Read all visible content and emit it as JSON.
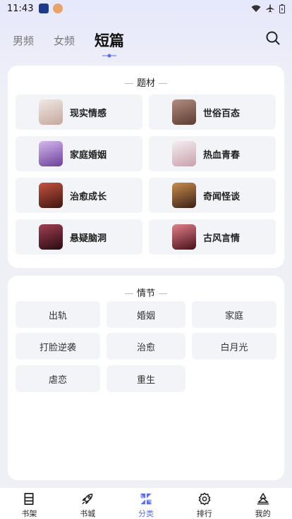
{
  "status": {
    "time": "11:43"
  },
  "header": {
    "tabs": [
      {
        "label": "男频"
      },
      {
        "label": "女频"
      },
      {
        "label": "短篇"
      }
    ]
  },
  "themes": {
    "title": "题材",
    "items": [
      {
        "label": "现实情感",
        "thumb_color": "#d8c9c4"
      },
      {
        "label": "世俗百态",
        "thumb_color": "#8a6258"
      },
      {
        "label": "家庭婚姻",
        "thumb_color": "#9b6fb8"
      },
      {
        "label": "热血青春",
        "thumb_color": "#d6cfd4"
      },
      {
        "label": "治愈成长",
        "thumb_color": "#7a2a25"
      },
      {
        "label": "奇闻怪谈",
        "thumb_color": "#6b3e2a"
      },
      {
        "label": "悬疑脑洞",
        "thumb_color": "#5a1a26"
      },
      {
        "label": "古风言情",
        "thumb_color": "#7a2630"
      }
    ]
  },
  "plots": {
    "title": "情节",
    "items": [
      {
        "label": "出轨"
      },
      {
        "label": "婚姻"
      },
      {
        "label": "家庭"
      },
      {
        "label": "打脸逆袭"
      },
      {
        "label": "治愈"
      },
      {
        "label": "白月光"
      },
      {
        "label": "虐恋"
      },
      {
        "label": "重生"
      }
    ]
  },
  "bottom_nav": [
    {
      "label": "书架",
      "icon": "bookshelf-icon"
    },
    {
      "label": "书城",
      "icon": "rocket-icon"
    },
    {
      "label": "分类",
      "icon": "category-icon"
    },
    {
      "label": "排行",
      "icon": "gear-icon"
    },
    {
      "label": "我的",
      "icon": "profile-icon"
    }
  ],
  "colors": {
    "accent": "#5b6ee8",
    "background": "#eff0f6",
    "tile": "#f3f4f7"
  }
}
